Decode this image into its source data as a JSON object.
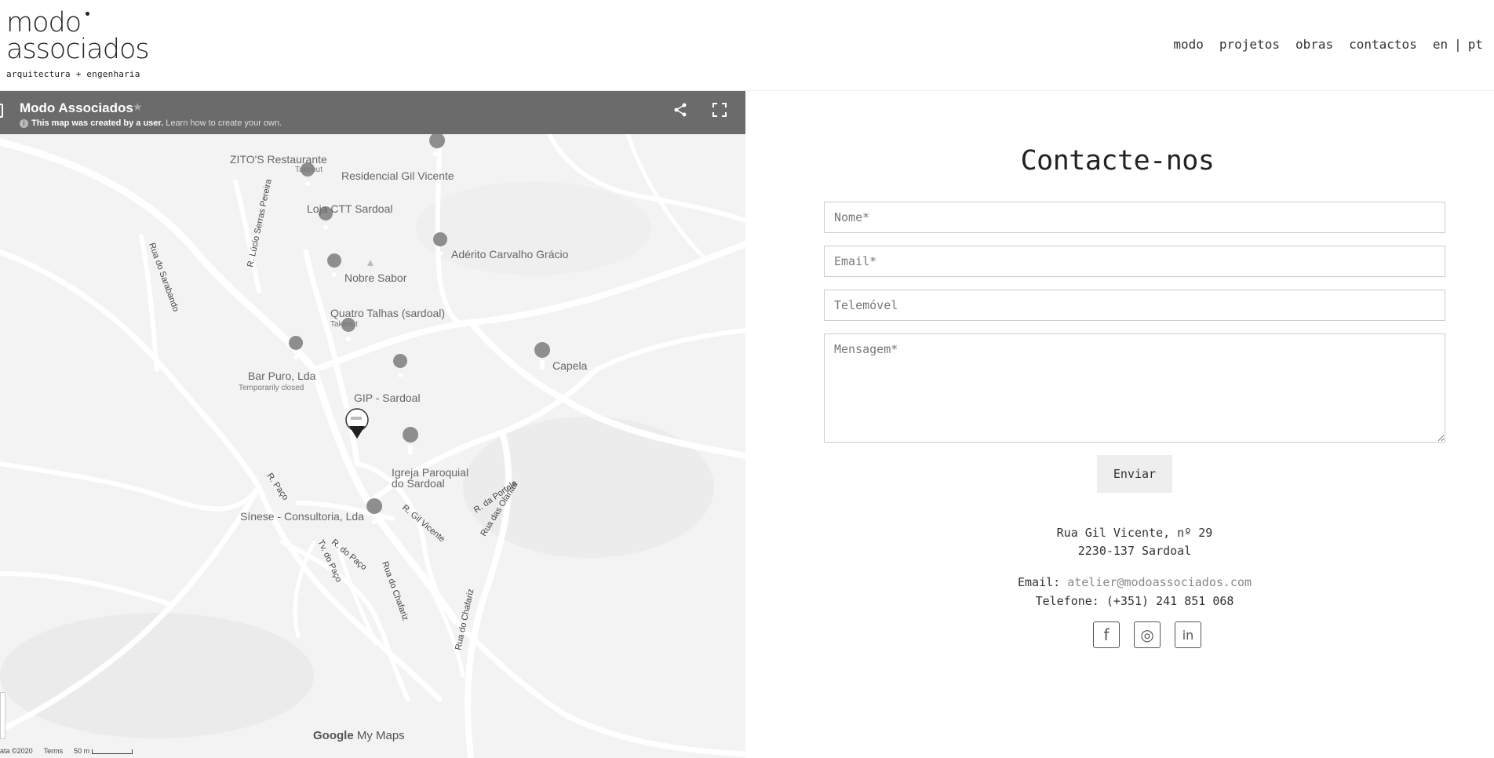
{
  "brand": {
    "line1": "modo",
    "line2": "associados",
    "tagline": "arquitectura + engenharia"
  },
  "nav": {
    "items": [
      {
        "label": "modo"
      },
      {
        "label": "projetos"
      },
      {
        "label": "obras"
      },
      {
        "label": "contactos"
      }
    ],
    "lang_en": "en",
    "lang_sep": "|",
    "lang_pt": "pt"
  },
  "map": {
    "title": "Modo Associados",
    "star": "★",
    "notice": "This map was created by a user.",
    "notice_link": "Learn how to create your own.",
    "pois": {
      "zitos": "ZITO'S Restaurante",
      "zitos_sub": "Takeout",
      "residencial": "Residencial Gil Vicente",
      "ctt": "Loja CTT Sardoal",
      "aderito": "Adérito Carvalho Grácio",
      "nobre": "Nobre Sabor",
      "quatro": "Quatro Talhas (sardoal)",
      "quatro_sub": "Takeout",
      "bar": "Bar Puro, Lda",
      "bar_sub": "Temporarily closed",
      "gip": "GIP - Sardoal",
      "capela": "Capela",
      "igreja1": "Igreja Paroquial",
      "igreja2": "do Sardoal",
      "sinese": "Sínese - Consultoria, Lda"
    },
    "streets": {
      "sarabando": "Rua do Sarabando",
      "lucio": "R. Lúcio Serras Pereira",
      "paco": "R. Paço",
      "gil": "R. Gil Vicente",
      "portela": "R. da Portela",
      "olarias": "Rua das Olarias",
      "rpaco": "R. do Paço",
      "tvpaco": "Tv. do Paço",
      "chafariz1": "Rua do Chafariz",
      "chafariz2": "Rua do Chafariz"
    },
    "logo_google": "Google",
    "logo_mymaps": "My Maps",
    "footer_data": "ata ©2020",
    "footer_terms": "Terms",
    "footer_scale": "50 m"
  },
  "contact": {
    "title": "Contacte-nos",
    "placeholders": {
      "name": "Nome*",
      "email": "Email*",
      "phone": "Telemóvel",
      "message": "Mensagem*"
    },
    "submit_label": "Enviar",
    "address_line1": "Rua Gil Vicente, nº 29",
    "address_line2": "2230-137 Sardoal",
    "email_label": "Email:",
    "email_value": "atelier@modoassociados.com",
    "phone_label": "Telefone:",
    "phone_value": "(+351) 241 851 068"
  },
  "social": {
    "facebook": "f",
    "instagram": "◎",
    "linkedin": "in"
  }
}
